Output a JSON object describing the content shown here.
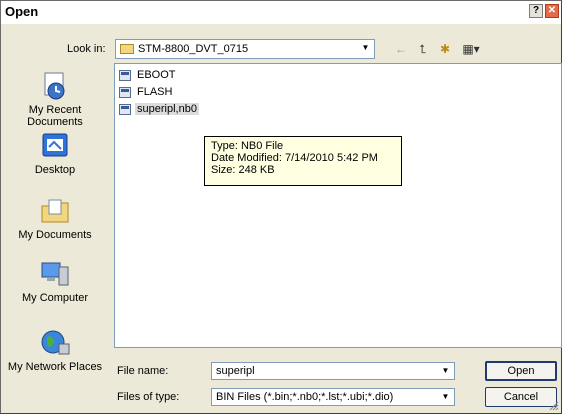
{
  "window": {
    "title": "Open"
  },
  "lookin": {
    "label": "Look in:",
    "value": "STM-8800_DVT_0715"
  },
  "places": [
    {
      "label": "My Recent Documents",
      "icon": "recent-documents-icon"
    },
    {
      "label": "Desktop",
      "icon": "desktop-icon"
    },
    {
      "label": "My Documents",
      "icon": "my-documents-icon"
    },
    {
      "label": "My Computer",
      "icon": "my-computer-icon"
    },
    {
      "label": "My Network Places",
      "icon": "network-places-icon"
    }
  ],
  "files": [
    {
      "name": "EBOOT",
      "selected": false
    },
    {
      "name": "FLASH",
      "selected": false
    },
    {
      "name": "superipl,nb0",
      "selected": true
    }
  ],
  "tooltip": {
    "type": "Type: NB0 File",
    "modified": "Date Modified: 7/14/2010 5:42 PM",
    "size": "Size: 248 KB"
  },
  "filename": {
    "label": "File name:",
    "value": "superipl"
  },
  "filetype": {
    "label": "Files of type:",
    "value": "BIN Files (*.bin;*.nb0;*.lst;*.ubi;*.dio)"
  },
  "buttons": {
    "open": "Open",
    "cancel": "Cancel"
  },
  "colors": {
    "selection": "#dcdcdc",
    "tooltip": "#ffffe1",
    "close": "#e36a4a"
  }
}
